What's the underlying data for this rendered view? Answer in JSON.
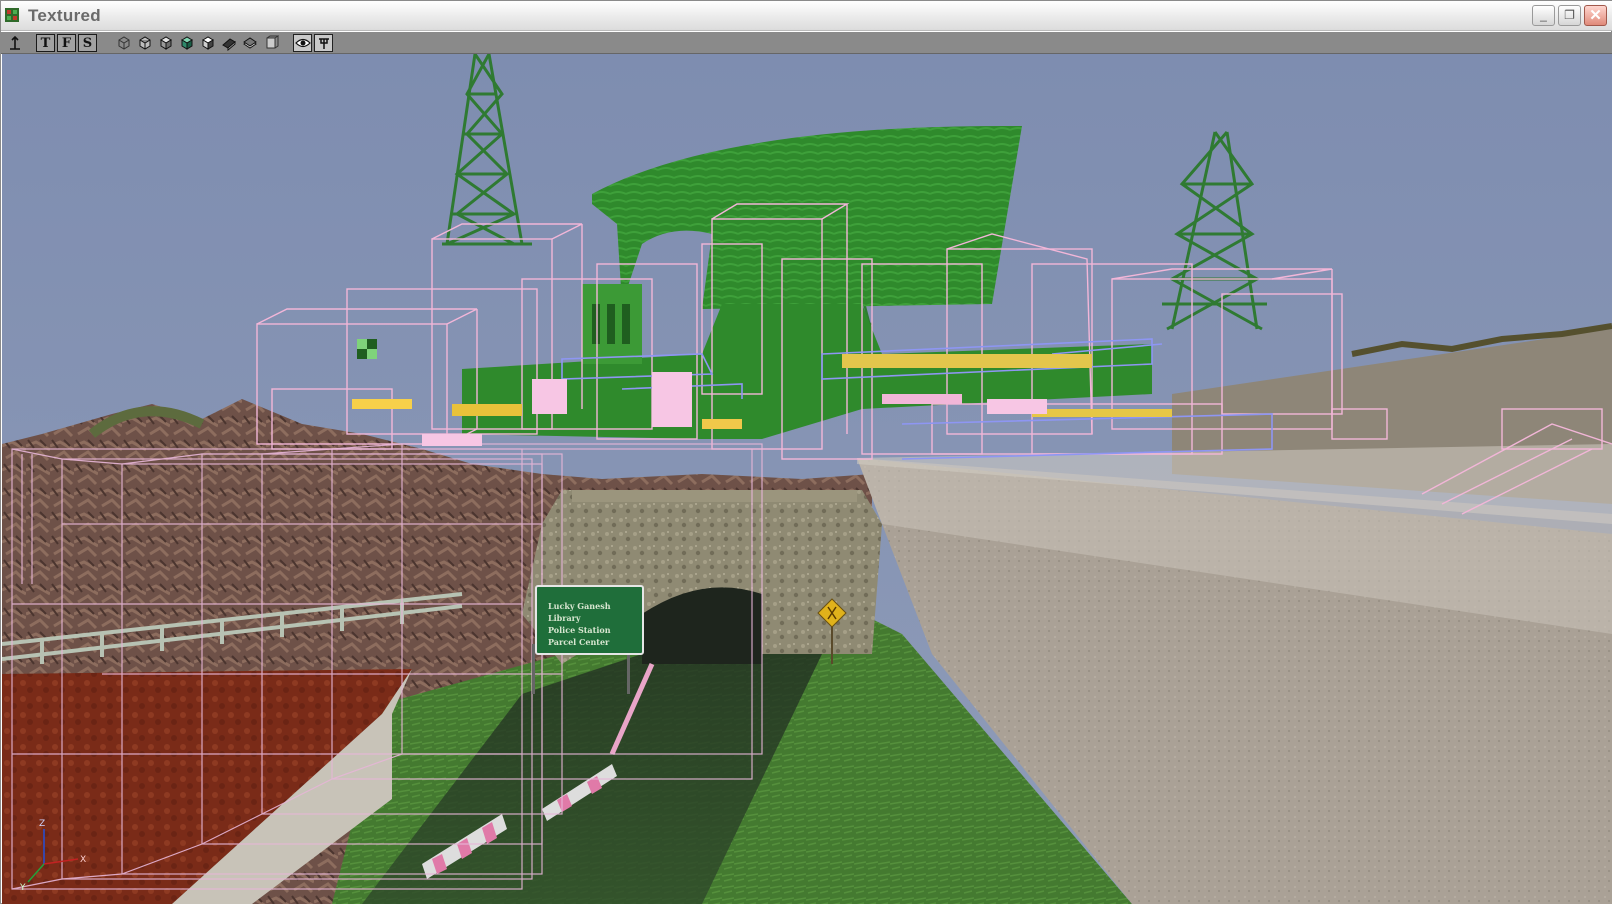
{
  "window": {
    "title": "Textured",
    "controls": {
      "minimize": "_",
      "maximize": "❐",
      "close": "✕"
    }
  },
  "toolbar": {
    "tools": [
      {
        "name": "select-tool-icon"
      },
      {
        "name": "top-view-button",
        "label": "T"
      },
      {
        "name": "front-view-button",
        "label": "F"
      },
      {
        "name": "side-view-button",
        "label": "S"
      },
      {
        "name": "wireframe-mode-icon"
      },
      {
        "name": "flat-shade-icon"
      },
      {
        "name": "textured-mode-icon"
      },
      {
        "name": "lit-mode-icon"
      },
      {
        "name": "solid-mode-icon"
      },
      {
        "name": "camera-mode-icon"
      },
      {
        "name": "layers-icon"
      },
      {
        "name": "bounds-icon"
      },
      {
        "name": "eye-icon"
      },
      {
        "name": "pin-icon"
      }
    ]
  },
  "scene": {
    "road_sign": {
      "lines": [
        "Lucky Ganesh",
        "Library",
        "Police Station",
        "Parcel Center"
      ]
    },
    "axis_labels": {
      "x": "X",
      "y": "Y",
      "z": "Z"
    },
    "colors": {
      "sky": "#8593b1",
      "grass": "#3f7a2e",
      "wall": "#a69c8f",
      "sign": "#1e6b3c",
      "wire_pink": "#f1b8d9",
      "wire_blue": "#8d95f4",
      "brick_red": "#7d2a17"
    }
  }
}
